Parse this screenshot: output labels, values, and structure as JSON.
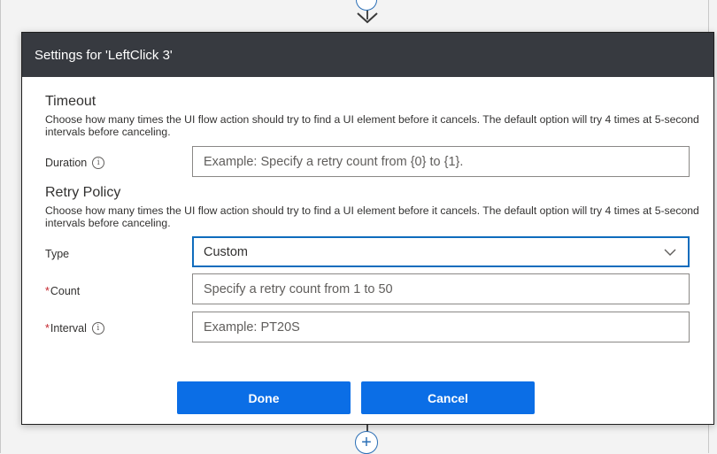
{
  "dialog": {
    "title": "Settings for 'LeftClick 3'"
  },
  "timeout": {
    "title": "Timeout",
    "description": "Choose how many times the UI flow action should try to find a UI element before it cancels. The default option will try 4 times at 5-second intervals before canceling.",
    "duration_label": "Duration",
    "duration_placeholder": "Example: Specify a retry count from {0} to {1}."
  },
  "retry_policy": {
    "title": "Retry Policy",
    "description": "Choose how many times the UI flow action should try to find a UI element before it cancels. The default option will try 4 times at 5-second intervals before canceling.",
    "type_label": "Type",
    "type_value": "Custom",
    "required_mark": "*",
    "count_label": "Count",
    "count_placeholder": "Specify a retry count from 1 to 50",
    "interval_label": "Interval",
    "interval_placeholder": "Example: PT20S"
  },
  "buttons": {
    "done": "Done",
    "cancel": "Cancel"
  },
  "canvas": {
    "add_step_symbol": "+"
  },
  "icons": {
    "info": "info-icon",
    "dropdown": "chevron-down-icon",
    "add": "plus-icon",
    "arrow": "down-arrow-icon"
  },
  "colors": {
    "header_bg": "#373a40",
    "primary_button": "#0b6ee6",
    "required": "#c4262e",
    "focus_border": "#0f6cbd"
  }
}
